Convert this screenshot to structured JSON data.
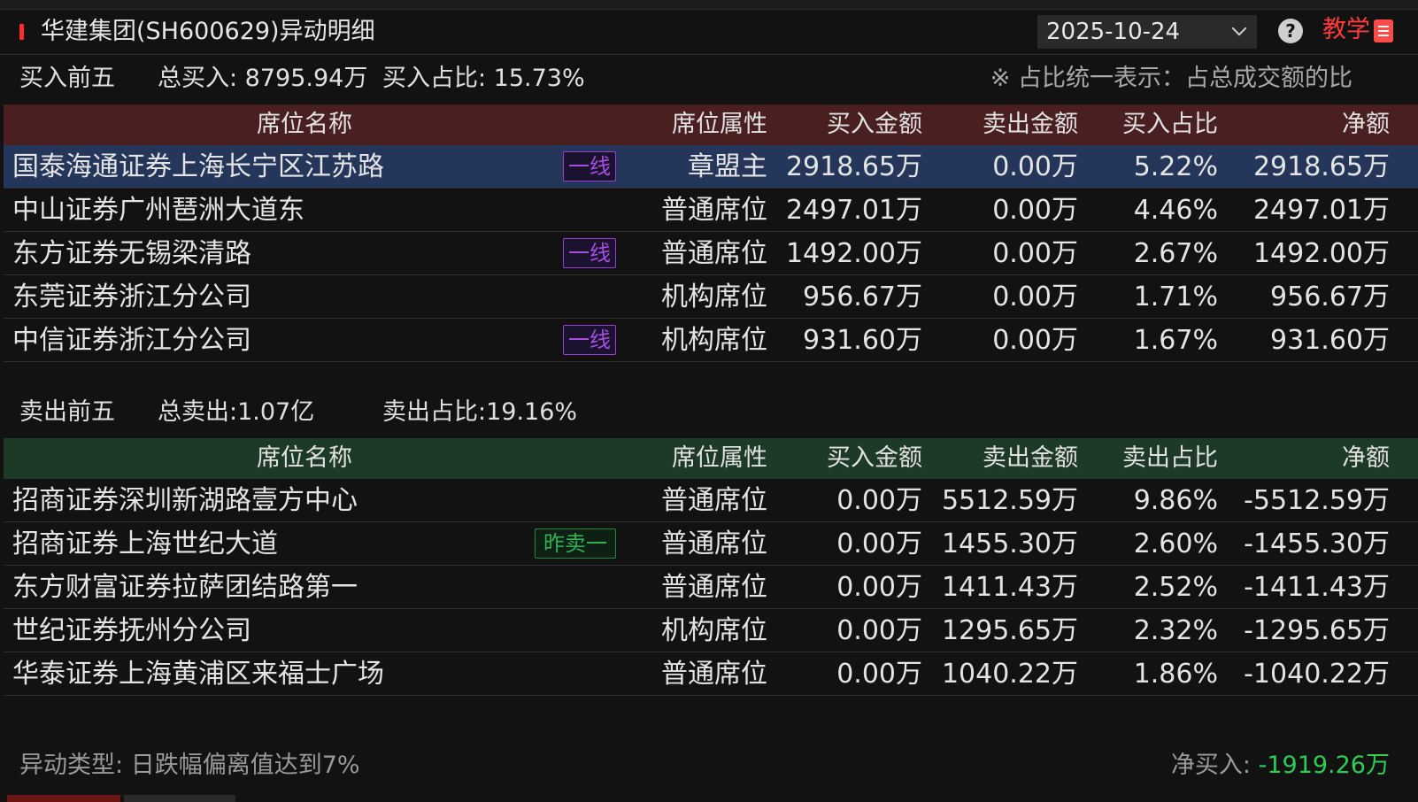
{
  "title": "华建集团(SH600629)异动明细",
  "date": "2025-10-24",
  "help_icon": "question-circle-icon",
  "teach_label": "教学",
  "teach_icon": "document-checklist-icon",
  "buy_summary": {
    "label": "买入前五",
    "total": "总买入: 8795.94万",
    "ratio": "买入占比: 15.73%",
    "note": "※ 占比统一表示：占总成交额的比"
  },
  "buy_table": {
    "headers": [
      "席位名称",
      "席位属性",
      "买入金额",
      "卖出金额",
      "买入占比",
      "净额"
    ],
    "rows": [
      {
        "name": "国泰海通证券上海长宁区江苏路",
        "tag": "一线",
        "attr": "章盟主",
        "buy": "2918.65万",
        "sell": "0.00万",
        "pct": "5.22%",
        "net": "2918.65万",
        "selected": true
      },
      {
        "name": "中山证券广州琶洲大道东",
        "tag": "",
        "attr": "普通席位",
        "buy": "2497.01万",
        "sell": "0.00万",
        "pct": "4.46%",
        "net": "2497.01万"
      },
      {
        "name": "东方证券无锡梁清路",
        "tag": "一线",
        "attr": "普通席位",
        "buy": "1492.00万",
        "sell": "0.00万",
        "pct": "2.67%",
        "net": "1492.00万"
      },
      {
        "name": "东莞证券浙江分公司",
        "tag": "",
        "attr": "机构席位",
        "buy": "956.67万",
        "sell": "0.00万",
        "pct": "1.71%",
        "net": "956.67万"
      },
      {
        "name": "中信证券浙江分公司",
        "tag": "一线",
        "attr": "机构席位",
        "buy": "931.60万",
        "sell": "0.00万",
        "pct": "1.67%",
        "net": "931.60万"
      }
    ]
  },
  "sell_summary": {
    "label": "卖出前五",
    "total": "总卖出:1.07亿",
    "ratio": "卖出占比:19.16%"
  },
  "sell_table": {
    "headers": [
      "席位名称",
      "席位属性",
      "买入金额",
      "卖出金额",
      "卖出占比",
      "净额"
    ],
    "rows": [
      {
        "name": "招商证券深圳新湖路壹方中心",
        "tag": "",
        "attr": "普通席位",
        "buy": "0.00万",
        "sell": "5512.59万",
        "pct": "9.86%",
        "net": "-5512.59万"
      },
      {
        "name": "招商证券上海世纪大道",
        "tag": "昨卖一",
        "attr": "普通席位",
        "buy": "0.00万",
        "sell": "1455.30万",
        "pct": "2.60%",
        "net": "-1455.30万"
      },
      {
        "name": "东方财富证券拉萨团结路第一",
        "tag": "",
        "attr": "普通席位",
        "buy": "0.00万",
        "sell": "1411.43万",
        "pct": "2.52%",
        "net": "-1411.43万"
      },
      {
        "name": "世纪证券抚州分公司",
        "tag": "",
        "attr": "机构席位",
        "buy": "0.00万",
        "sell": "1295.65万",
        "pct": "2.32%",
        "net": "-1295.65万"
      },
      {
        "name": "华泰证券上海黄浦区来福士广场",
        "tag": "",
        "attr": "普通席位",
        "buy": "0.00万",
        "sell": "1040.22万",
        "pct": "1.86%",
        "net": "-1040.22万"
      }
    ]
  },
  "footer": {
    "type_label": "异动类型:",
    "type_value": "日跌幅偏离值达到7%",
    "net_label": "净买入:",
    "net_value": "-1919.26万"
  },
  "colors": {
    "buy_header_bg": "#4a1f1f",
    "sell_header_bg": "#1c3a25",
    "selected_row_bg": "#24365a",
    "negative": "#2ecc54",
    "accent_red": "#ff3b3b",
    "tag_line": "#a64ee0",
    "tag_yesterday_sell": "#2fb055"
  }
}
